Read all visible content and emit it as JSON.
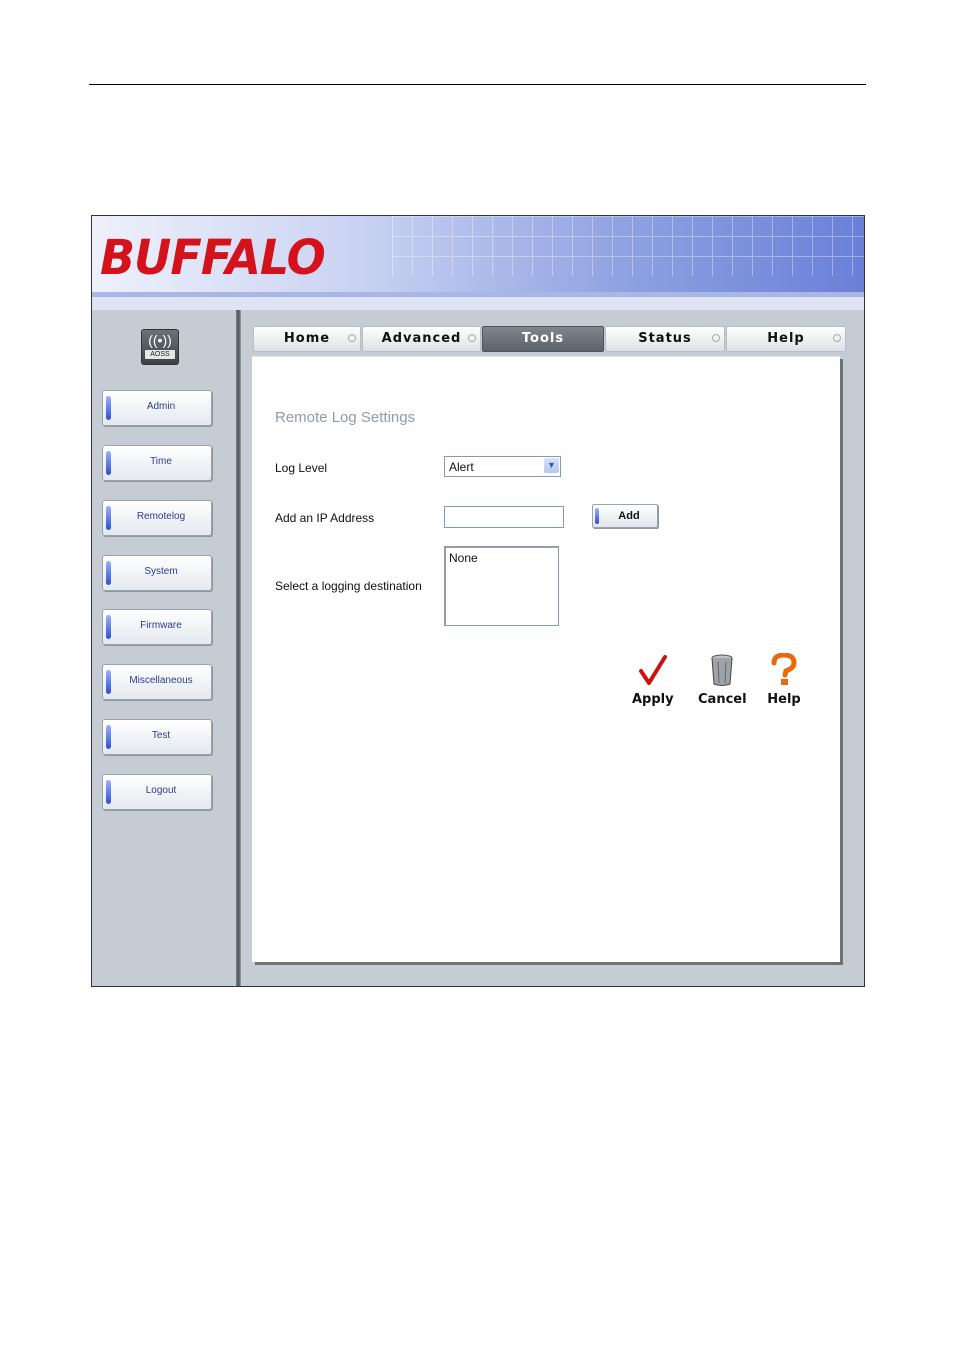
{
  "brand": {
    "logo_text": "BUFFALO"
  },
  "aoss": {
    "label": "AOSS"
  },
  "sidebar": {
    "items": [
      {
        "label": "Admin"
      },
      {
        "label": "Time"
      },
      {
        "label": "Remotelog"
      },
      {
        "label": "System"
      },
      {
        "label": "Firmware"
      },
      {
        "label": "Miscellaneous"
      },
      {
        "label": "Test"
      },
      {
        "label": "Logout"
      }
    ]
  },
  "tabs": [
    {
      "label": "Home",
      "active": false
    },
    {
      "label": "Advanced",
      "active": false
    },
    {
      "label": "Tools",
      "active": true
    },
    {
      "label": "Status",
      "active": false
    },
    {
      "label": "Help",
      "active": false
    }
  ],
  "form": {
    "title": "Remote Log Settings",
    "log_level_label": "Log Level",
    "log_level_value": "Alert",
    "ip_label": "Add an IP Address",
    "ip_value": "",
    "add_button": "Add",
    "destination_label": "Select a logging destination",
    "destination_option": "None"
  },
  "actions": {
    "apply": "Apply",
    "cancel": "Cancel",
    "help": "Help"
  },
  "colors": {
    "logo": "#d3121b",
    "section_title": "#8a9eae",
    "active_tab": "#5c6369",
    "apply_check": "#cc1111",
    "help_mark": "#e86a10"
  }
}
